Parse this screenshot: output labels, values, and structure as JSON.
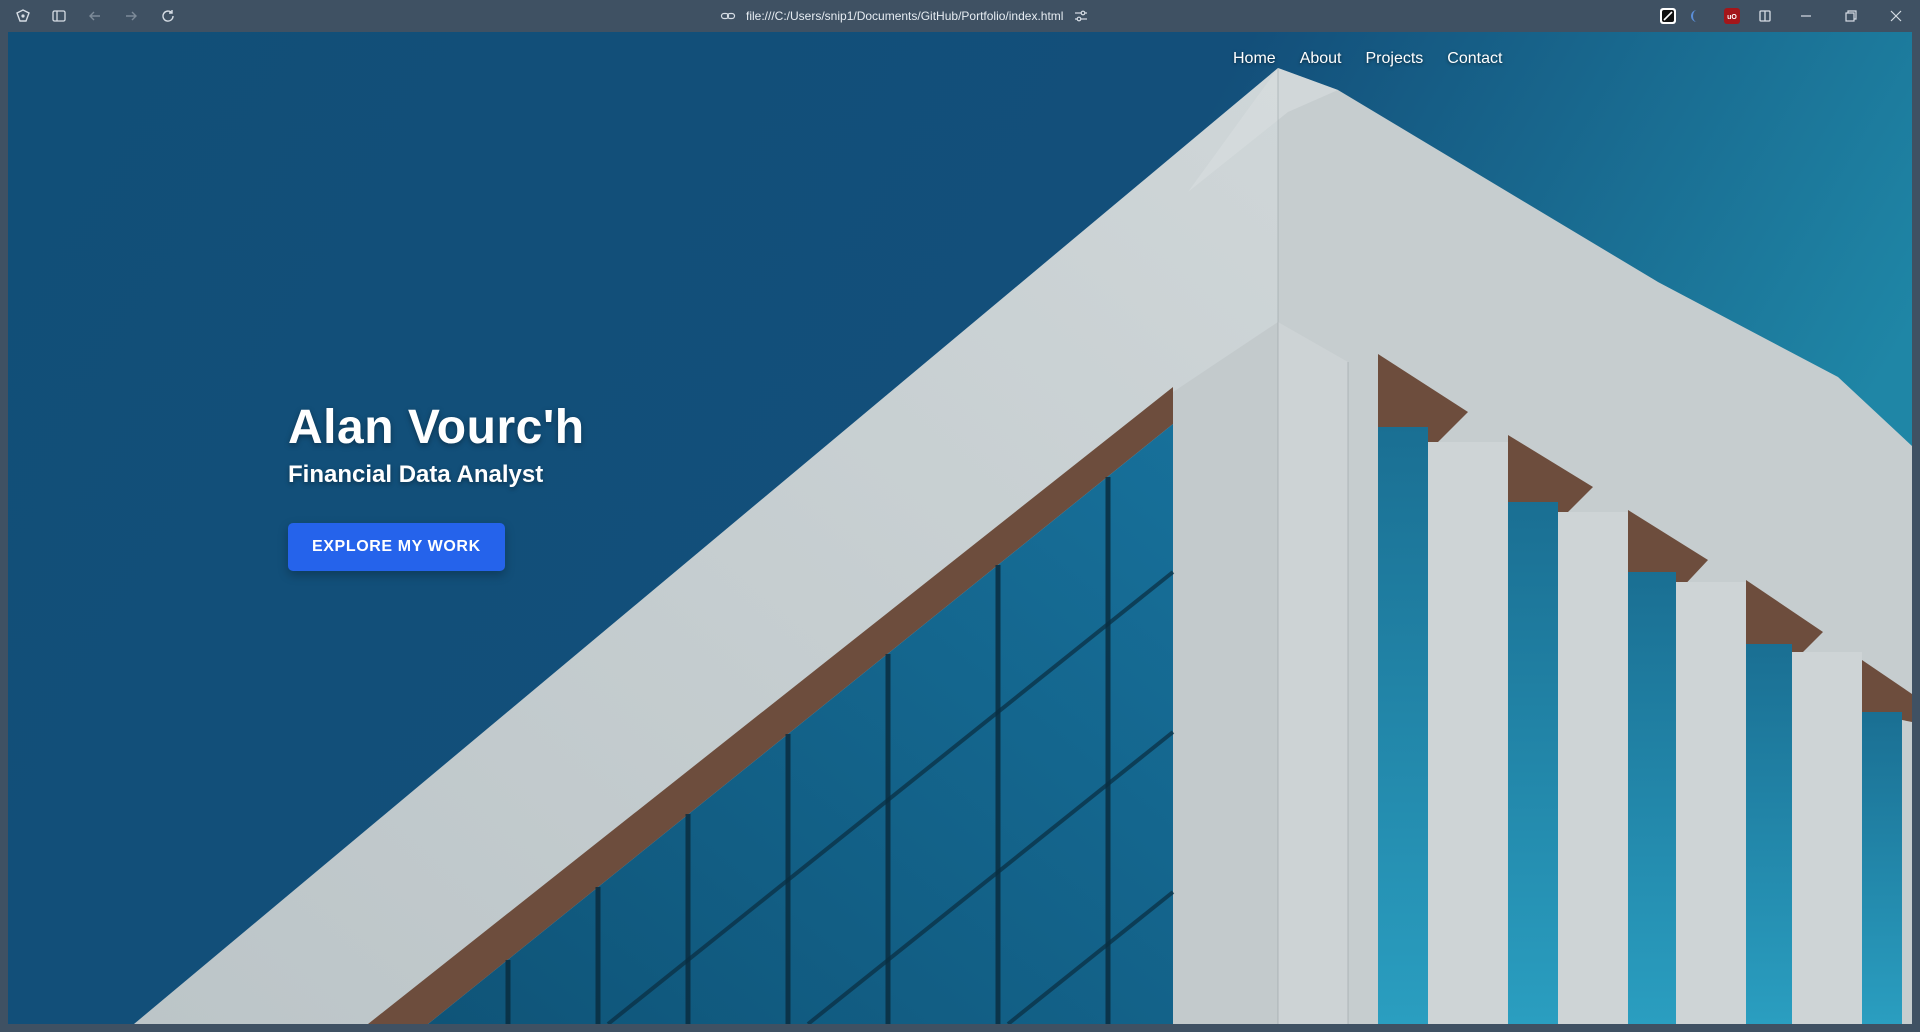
{
  "browser": {
    "url": "file:///C:/Users/snip1/Documents/GitHub/Portfolio/index.html",
    "icons": {
      "app_menu": "vivaldi-menu-icon",
      "panel_toggle": "panel-toggle-icon",
      "back": "back-arrow-icon",
      "forward": "forward-arrow-icon",
      "reload": "reload-icon",
      "link": "link-icon",
      "site_settings": "sliders-icon",
      "split_view": "split-view-icon",
      "minimize": "minimize-icon",
      "restore": "restore-icon",
      "close": "close-icon"
    }
  },
  "site": {
    "nav": {
      "home": "Home",
      "about": "About",
      "projects": "Projects",
      "contact": "Contact"
    },
    "hero": {
      "name": "Alan Vourc'h",
      "role": "Financial Data Analyst",
      "cta_label": "EXPLORE MY WORK"
    }
  },
  "colors": {
    "chrome": "#3f5163",
    "sky_left": "#114f78",
    "sky_right": "#1f86a6",
    "cta": "#2563eb",
    "facade": "#c9d1d3",
    "window_glass": "#15698d"
  }
}
